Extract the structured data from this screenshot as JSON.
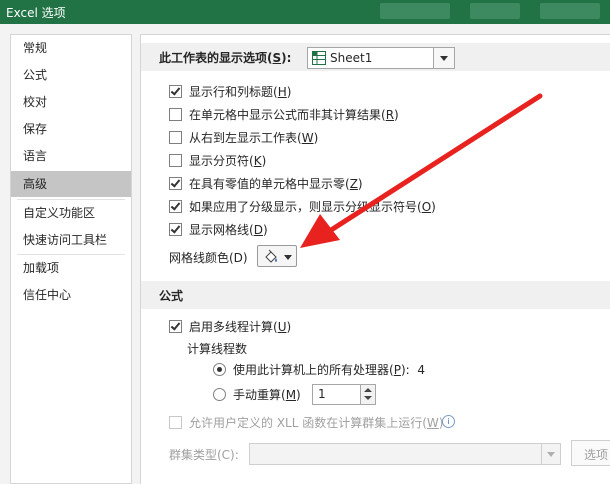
{
  "window": {
    "title": "Excel 选项"
  },
  "sidebar": {
    "items": [
      {
        "label": "常规"
      },
      {
        "label": "公式"
      },
      {
        "label": "校对"
      },
      {
        "label": "保存"
      },
      {
        "label": "语言"
      },
      {
        "label": "高级",
        "selected": true
      },
      {
        "label": "自定义功能区"
      },
      {
        "label": "快速访问工具栏"
      },
      {
        "label": "加载项"
      },
      {
        "label": "信任中心"
      }
    ]
  },
  "worksheet_section": {
    "label_prefix": "此工作表的显示选项(",
    "label_key": "S",
    "label_suffix": "):",
    "sheet_select": {
      "value": "Sheet1",
      "icon": "sheet-icon"
    },
    "options": [
      {
        "pre": "显示行和列标题(",
        "key": "H",
        "post": ")",
        "checked": true
      },
      {
        "pre": "在单元格中显示公式而非其计算结果(",
        "key": "R",
        "post": ")",
        "checked": false
      },
      {
        "pre": "从右到左显示工作表(",
        "key": "W",
        "post": ")",
        "checked": false
      },
      {
        "pre": "显示分页符(",
        "key": "K",
        "post": ")",
        "checked": false
      },
      {
        "pre": "在具有零值的单元格中显示零(",
        "key": "Z",
        "post": ")",
        "checked": true
      },
      {
        "pre": "如果应用了分级显示，则显示分级显示符号(",
        "key": "O",
        "post": ")",
        "checked": true
      },
      {
        "pre": "显示网格线(",
        "key": "D",
        "post": ")",
        "checked": true
      }
    ],
    "gridline_color_label": "网格线颜色(D)",
    "gridline_color_icon": "paint-bucket-icon"
  },
  "formula_section": {
    "title": "公式",
    "multithread": {
      "pre": "启用多线程计算(",
      "key": "U",
      "post": ")",
      "checked": true
    },
    "threads_label": "计算线程数",
    "use_all": {
      "pre": "使用此计算机上的所有处理器(",
      "key": "P",
      "post": "):",
      "value": "4",
      "selected": true
    },
    "manual": {
      "pre": "手动重算(",
      "key": "M",
      "post": ")",
      "value": "1",
      "selected": false
    },
    "xll": {
      "pre": "允许用户定义的 XLL 函数在计算群集上运行(",
      "key": "W",
      "post": ")",
      "checked": false
    },
    "cluster_type_label": "群集类型(C):",
    "options_button": "选项"
  },
  "colors": {
    "title_bar": "#217346",
    "arrow": "#e8221f",
    "selected_sidebar": "#c5c5c5"
  }
}
